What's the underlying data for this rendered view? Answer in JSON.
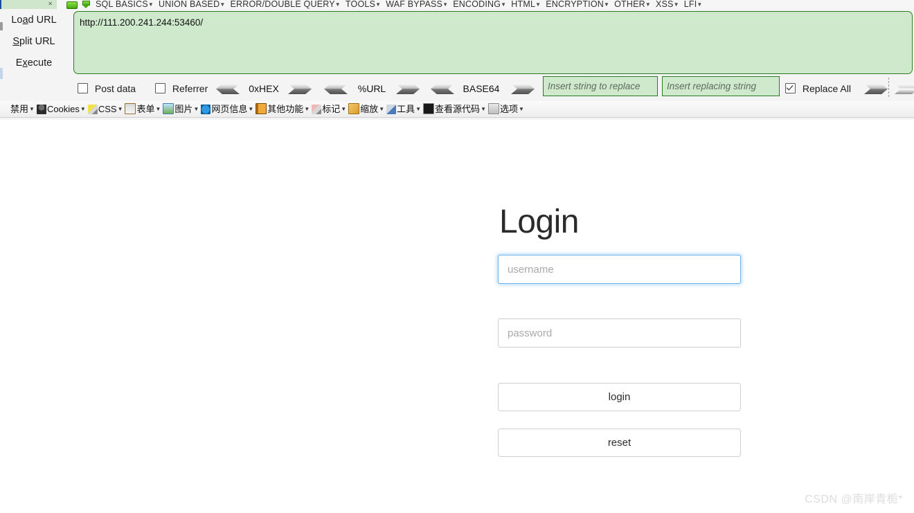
{
  "hackbar": {
    "top_menu": [
      {
        "label": "SQL BASICS"
      },
      {
        "label": "UNION BASED"
      },
      {
        "label": "ERROR/DOUBLE QUERY"
      },
      {
        "label": "TOOLS"
      },
      {
        "label": "WAF BYPASS"
      },
      {
        "label": "ENCODING"
      },
      {
        "label": "HTML"
      },
      {
        "label": "ENCRYPTION"
      },
      {
        "label": "OTHER"
      },
      {
        "label": "XSS"
      },
      {
        "label": "LFI"
      }
    ],
    "actions": [
      {
        "name": "load-url",
        "pre": "Lo",
        "key": "a",
        "post": "d URL"
      },
      {
        "name": "split-url",
        "pre": "",
        "key": "S",
        "post": "plit URL"
      },
      {
        "name": "execute",
        "pre": "E",
        "key": "x",
        "post": "ecute"
      }
    ],
    "url_value": "http://111.200.241.244:53460/",
    "options": {
      "post_data_label": "Post data",
      "post_data_checked": false,
      "referrer_label": "Referrer",
      "referrer_checked": false,
      "replace_all_label": "Replace All",
      "replace_all_checked": true
    },
    "encoders": [
      {
        "label": "0xHEX"
      },
      {
        "label": "%URL"
      },
      {
        "label": "BASE64"
      }
    ],
    "replace_fields": [
      {
        "placeholder": "Insert string to replace"
      },
      {
        "placeholder": "Insert replacing string"
      }
    ],
    "cn_toolbar": [
      {
        "label": "禁用",
        "icon": "ban-icon",
        "icon_class": "ci-ban"
      },
      {
        "label": "Cookies",
        "icon": "person-icon",
        "icon_class": "ci-person"
      },
      {
        "label": "CSS",
        "icon": "pen-icon",
        "icon_class": "ci-pen"
      },
      {
        "label": "表单",
        "icon": "clipboard-icon",
        "icon_class": "ci-form"
      },
      {
        "label": "图片",
        "icon": "image-icon",
        "icon_class": "ci-image"
      },
      {
        "label": "网页信息",
        "icon": "info-icon",
        "icon_class": "ci-info"
      },
      {
        "label": "其他功能",
        "icon": "book-icon",
        "icon_class": "ci-book"
      },
      {
        "label": "标记",
        "icon": "marker-icon",
        "icon_class": "ci-marker"
      },
      {
        "label": "缩放",
        "icon": "ruler-icon",
        "icon_class": "ci-ruler"
      },
      {
        "label": "工具",
        "icon": "tools-icon",
        "icon_class": "ci-tools"
      },
      {
        "label": "查看源代码",
        "icon": "source-code-icon",
        "icon_class": "ci-source"
      },
      {
        "label": "选项",
        "icon": "options-icon",
        "icon_class": "ci-opt"
      }
    ]
  },
  "page": {
    "title": "Login",
    "username_placeholder": "username",
    "username_value": "",
    "password_placeholder": "password",
    "password_value": "",
    "login_button": "login",
    "reset_button": "reset",
    "watermark": "CSDN @南岸青栀*"
  },
  "colors": {
    "hackbar_green_bg": "#cfe9cd",
    "hackbar_green_border": "#2a7b1f",
    "focus_blue": "#6cb2eb",
    "toolbar_bg": "#f4f4f4",
    "watermark_gray": "#dcdcdc"
  }
}
